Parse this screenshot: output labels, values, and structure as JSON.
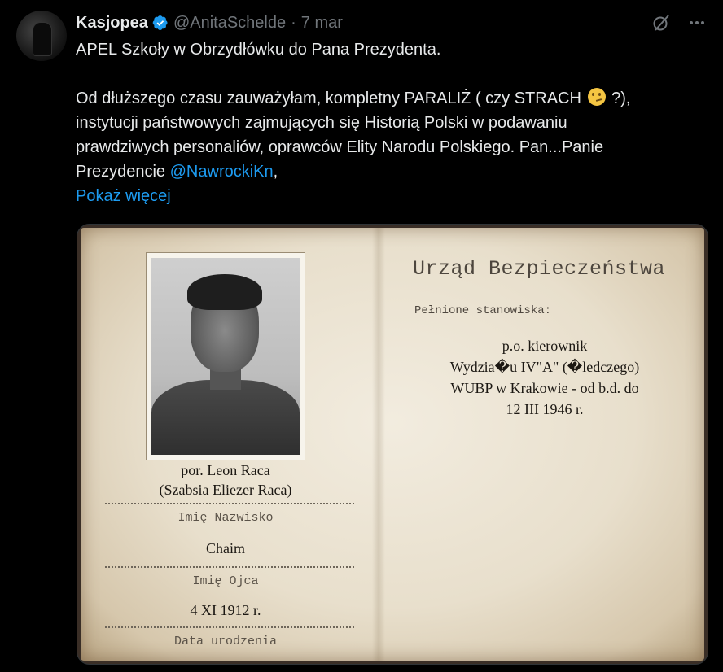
{
  "tweet": {
    "display_name": "Kasjopea",
    "handle": "@AnitaSchelde",
    "separator": "·",
    "date": "7 mar",
    "line1": "APEL Szkoły w Obrzydłówku do Pana Prezydenta.",
    "line2_before": "Od dłuższego czasu zauważyłam, kompletny PARALIŻ ( czy STRACH ",
    "line2_after": " ?),",
    "line3": "instytucji państwowych zajmujących się Historią Polski w podawaniu",
    "line4": "prawdziwych personaliów, oprawców Elity Narodu Polskiego. Pan...Panie",
    "line5_before": "Prezydencie ",
    "mention": "@NawrockiKn",
    "line5_after": ",",
    "show_more": "Pokaż więcej",
    "icons": {
      "verified": "verified-badge-icon",
      "grok": "grok-icon",
      "more": "more-icon",
      "emoji": "thinking-face-emoji"
    }
  },
  "document": {
    "name_line1": "por. Leon Raca",
    "name_line2": "(Szabsia Eliezer Raca)",
    "label_name": "Imię Nazwisko",
    "father_value": "Chaim",
    "label_father": "Imię Ojca",
    "birth_value": "4 XI 1912 r.",
    "label_birth": "Data urodzenia",
    "office_title": "Urząd Bezpieczeństwa",
    "positions_label": "Pełnione stanowiska:",
    "position_lines": [
      "p.o. kierownik",
      "Wydzia�u IV\"A\" (�ledczego)",
      "WUBP w Krakowie - od b.d. do",
      "12 III 1946 r."
    ]
  },
  "colors": {
    "accent": "#1d9bf0",
    "muted": "#71767b",
    "text": "#e7e9ea",
    "background": "#000000"
  }
}
